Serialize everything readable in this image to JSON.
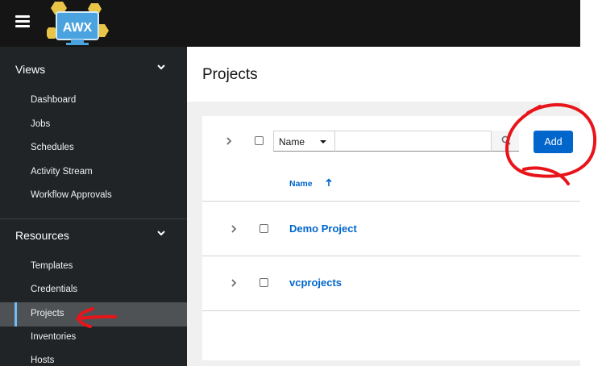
{
  "app": {
    "logo_text": "AWX"
  },
  "sidebar": {
    "views": {
      "label": "Views",
      "items": [
        {
          "label": "Dashboard"
        },
        {
          "label": "Jobs"
        },
        {
          "label": "Schedules"
        },
        {
          "label": "Activity Stream"
        },
        {
          "label": "Workflow Approvals"
        }
      ]
    },
    "resources": {
      "label": "Resources",
      "items": [
        {
          "label": "Templates"
        },
        {
          "label": "Credentials"
        },
        {
          "label": "Projects",
          "active": true
        },
        {
          "label": "Inventories"
        },
        {
          "label": "Hosts"
        }
      ]
    }
  },
  "page": {
    "title": "Projects"
  },
  "toolbar": {
    "filter_select": "Name",
    "search_value": "",
    "add_label": "Add"
  },
  "table": {
    "columns": [
      {
        "label": "Name",
        "sort": "ascending"
      }
    ],
    "rows": [
      {
        "name": "Demo Project"
      },
      {
        "name": "vcprojects"
      }
    ]
  },
  "colors": {
    "brand": "#0066cc",
    "topbar": "#151515",
    "sidebar": "#212427",
    "annotation": "#e8141a"
  }
}
